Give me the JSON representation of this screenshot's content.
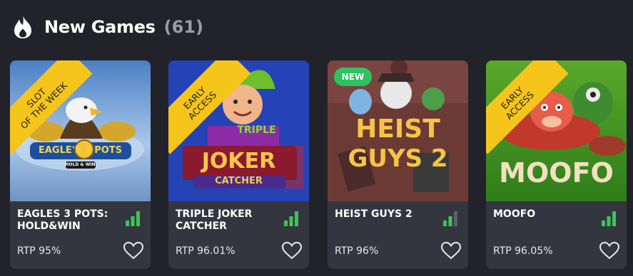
{
  "section": {
    "title": "New Games",
    "count": "(61)",
    "icon": "flame-icon"
  },
  "colors": {
    "background": "#22232a",
    "card": "#34363f",
    "ribbon": "#f6c51b",
    "new_badge": "#2ec35f",
    "signal_on": "#3cc45a",
    "signal_off": "#5e606a"
  },
  "games": [
    {
      "name": "EAGLES 3 POTS: HOLD&WIN",
      "rtp": "RTP 95%",
      "ribbon_line1": "SLOT",
      "ribbon_line2": "OF THE WEEK",
      "art_title": "EAGLE'S 3 POTS",
      "art_subtitle": "HOLD & WIN",
      "volatility_level": 3
    },
    {
      "name": "TRIPLE JOKER CATCHER",
      "rtp": "RTP 96.01%",
      "ribbon_line1": "EARLY",
      "ribbon_line2": "ACCESS",
      "art_title_top": "TRIPLE",
      "art_title_main": "JOKER",
      "art_title_bottom": "CATCHER",
      "volatility_level": 3
    },
    {
      "name": "HEIST GUYS 2",
      "rtp": "RTP 96%",
      "badge": "NEW",
      "art_title_top": "HEIST",
      "art_title_bottom": "GUYS 2",
      "volatility_level": 2
    },
    {
      "name": "MOOFO",
      "rtp": "RTP 96.05%",
      "ribbon_line1": "EARLY",
      "ribbon_line2": "ACCESS",
      "art_title": "MOOFO",
      "volatility_level": 3
    }
  ]
}
